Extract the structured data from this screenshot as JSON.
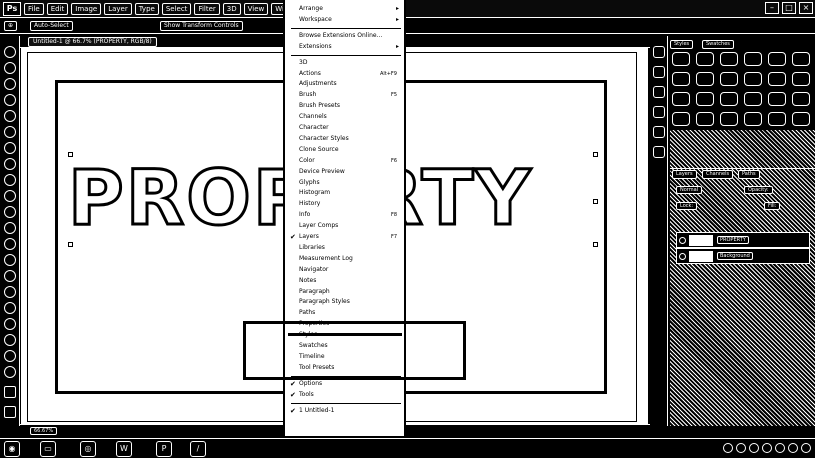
{
  "app": {
    "logo": "Ps"
  },
  "menubar": {
    "items": [
      "File",
      "Edit",
      "Image",
      "Layer",
      "Type",
      "Select",
      "Filter",
      "3D",
      "View",
      "Window"
    ]
  },
  "optionsbar": {
    "auto_select": "Auto-Select",
    "transform": "Show Transform Controls"
  },
  "document": {
    "tab_title": "Untitled-1 @ 66.7% (PROPERTY, RGB/8)",
    "canvas_text": "PROPERTY"
  },
  "window_menu": {
    "items": [
      {
        "label": "Arrange",
        "submenu": true
      },
      {
        "label": "Workspace",
        "submenu": true
      },
      {
        "separator": true
      },
      {
        "label": "Browse Extensions Online..."
      },
      {
        "label": "Extensions",
        "submenu": true
      },
      {
        "separator": true
      },
      {
        "label": "3D"
      },
      {
        "label": "Actions",
        "shortcut": "Alt+F9"
      },
      {
        "label": "Adjustments"
      },
      {
        "label": "Brush",
        "shortcut": "F5"
      },
      {
        "label": "Brush Presets"
      },
      {
        "label": "Channels"
      },
      {
        "label": "Character"
      },
      {
        "label": "Character Styles"
      },
      {
        "label": "Clone Source"
      },
      {
        "label": "Color",
        "shortcut": "F6"
      },
      {
        "label": "Device Preview"
      },
      {
        "label": "Glyphs"
      },
      {
        "label": "Histogram"
      },
      {
        "label": "History"
      },
      {
        "label": "Info",
        "shortcut": "F8"
      },
      {
        "label": "Layer Comps"
      },
      {
        "label": "Layers",
        "shortcut": "F7",
        "checked": true
      },
      {
        "label": "Libraries"
      },
      {
        "label": "Measurement Log"
      },
      {
        "label": "Navigator"
      },
      {
        "label": "Notes"
      },
      {
        "label": "Paragraph"
      },
      {
        "label": "Paragraph Styles"
      },
      {
        "label": "Paths"
      },
      {
        "label": "Properties"
      },
      {
        "label": "Styles",
        "highlighted": true
      },
      {
        "label": "Swatches"
      },
      {
        "label": "Timeline"
      },
      {
        "label": "Tool Presets"
      },
      {
        "separator": true
      },
      {
        "label": "Options",
        "checked": true
      },
      {
        "label": "Tools",
        "checked": true
      },
      {
        "separator": true
      },
      {
        "label": "1 Untitled-1",
        "checked": true
      }
    ]
  },
  "panels": {
    "top_tabs": [
      "Styles",
      "Swatches"
    ],
    "layers_tabs": [
      "Layers",
      "Channels",
      "Paths"
    ],
    "blend_mode": "Normal",
    "opacity_label": "Opacity:",
    "lock_label": "Lock:",
    "fill_label": "Fill:",
    "layer_names": [
      "PROPERTY",
      "Background"
    ]
  },
  "statusbar": {
    "zoom": "66.67%"
  }
}
